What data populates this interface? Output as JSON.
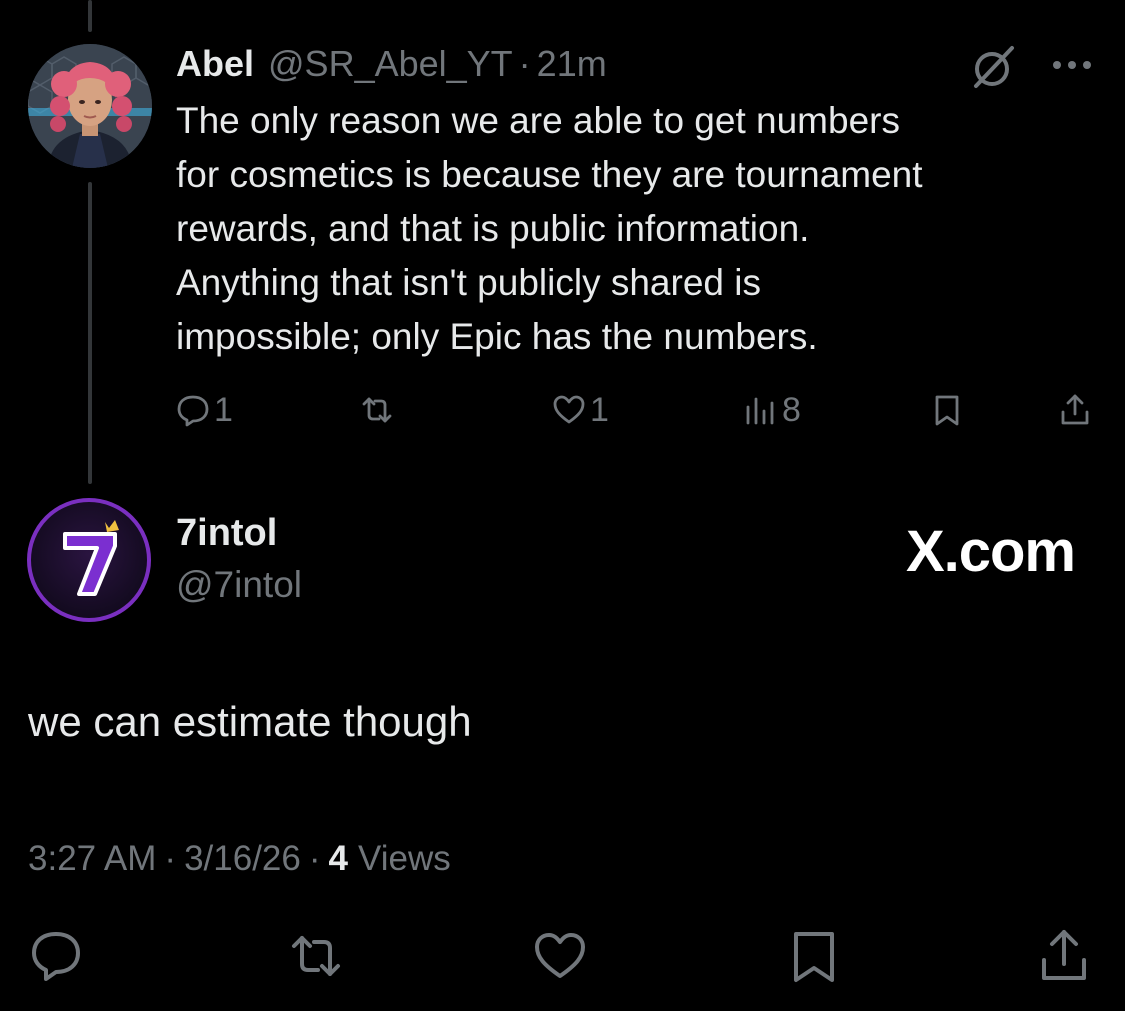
{
  "reply": {
    "name": "Abel",
    "handle": "@SR_Abel_YT",
    "separator": "·",
    "time": "21m",
    "lines": [
      "The only reason we are able to get numbers",
      "for cosmetics is because they are tournament",
      "rewards, and that is public information.",
      "Anything that isn't publicly shared is",
      "impossible; only Epic has the numbers."
    ],
    "actions": {
      "replies": "1",
      "reposts": "",
      "likes": "1",
      "views": "8"
    },
    "icons": [
      "grok-icon",
      "more-icon",
      "reply-icon",
      "repost-icon",
      "like-icon",
      "views-icon",
      "bookmark-icon",
      "share-icon"
    ]
  },
  "tweet": {
    "name": "7intol",
    "handle": "@7intol",
    "avatar_glyph": "7",
    "watermark": "X.com",
    "text": "we can estimate though",
    "time": "3:27 AM",
    "date": "3/16/26",
    "separator": "·",
    "views_count": "4",
    "views_label": "Views",
    "icons": [
      "reply-icon",
      "repost-icon",
      "like-icon",
      "bookmark-icon",
      "share-icon"
    ]
  },
  "colors": {
    "background": "#000000",
    "text": "#e7e9ea",
    "secondary": "#71767b",
    "thread_line": "#333639",
    "avatar_ring": "#7a2fc0"
  }
}
